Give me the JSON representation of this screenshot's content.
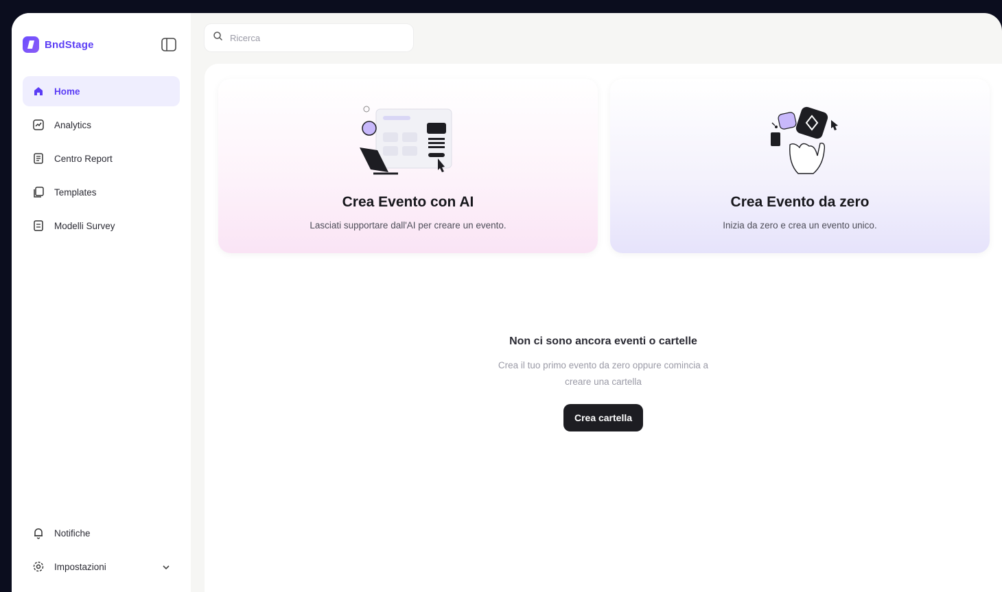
{
  "brand": {
    "name": "BndStage",
    "logo_icon": "brand-logo-icon",
    "accent": "#5b3df5"
  },
  "sidebar": {
    "items": [
      {
        "label": "Home",
        "icon": "home-icon",
        "active": true
      },
      {
        "label": "Analytics",
        "icon": "chart-icon",
        "active": false
      },
      {
        "label": "Centro Report",
        "icon": "report-icon",
        "active": false
      },
      {
        "label": "Templates",
        "icon": "templates-icon",
        "active": false
      },
      {
        "label": "Modelli Survey",
        "icon": "survey-icon",
        "active": false
      }
    ],
    "bottom_items": [
      {
        "label": "Notifiche",
        "icon": "bell-icon"
      },
      {
        "label": "Impostazioni",
        "icon": "gear-icon"
      }
    ]
  },
  "search": {
    "placeholder": "Ricerca"
  },
  "cards": [
    {
      "title": "Crea Evento con AI",
      "description": "Lasciati supportare dall'AI per creare un evento."
    },
    {
      "title": "Crea Evento da zero",
      "description": "Inizia da zero e crea un evento unico."
    }
  ],
  "empty_state": {
    "title": "Non ci sono ancora eventi o cartelle",
    "description": "Crea il tuo primo evento da zero oppure comincia a creare una cartella",
    "button_label": "Crea cartella"
  },
  "colors": {
    "background": "#0b0d1e",
    "active_nav_bg": "#efeefe",
    "button_dark": "#1d1d22"
  }
}
